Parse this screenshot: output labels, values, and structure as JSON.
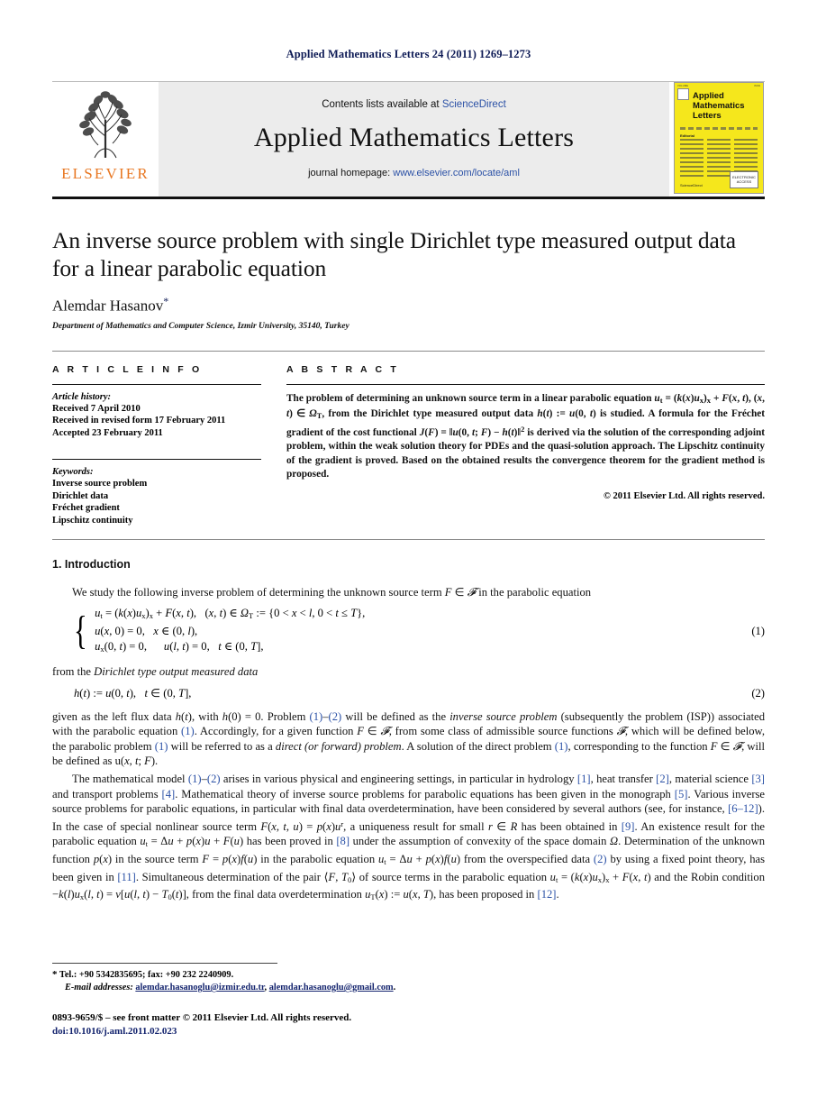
{
  "running_head": "Applied Mathematics Letters 24 (2011) 1269–1273",
  "masthead": {
    "publisher_name": "ELSEVIER",
    "contents_prefix": "Contents lists available at ",
    "contents_link": "ScienceDirect",
    "journal_title": "Applied Mathematics Letters",
    "homepage_prefix": "journal homepage: ",
    "homepage_link": "www.elsevier.com/locate/aml",
    "cover": {
      "line1": "Applied",
      "line2": "Mathematics",
      "line3": "Letters",
      "editorial_label": "Editorial",
      "sciencedirect": "ScienceDirect",
      "badge": "ELECTRONIC ACCESS"
    }
  },
  "title": "An inverse source problem with single Dirichlet type measured output data for a linear parabolic equation",
  "author": "Alemdar Hasanov",
  "author_marker": "*",
  "affiliation": "Department of Mathematics and Computer Science, Izmir University, 35140, Turkey",
  "article_info": {
    "heading": "A R T I C L E    I N F O",
    "history_label": "Article history:",
    "history": [
      "Received 7 April 2010",
      "Received in revised form 17 February 2011",
      "Accepted 23 February 2011"
    ],
    "keywords_label": "Keywords:",
    "keywords": [
      "Inverse source problem",
      "Dirichlet data",
      "Fréchet gradient",
      "Lipschitz continuity"
    ]
  },
  "abstract": {
    "heading": "A B S T R A C T",
    "text": "The problem of determining an unknown source term in a linear parabolic equation u_t = (k(x)u_x)_x + F(x, t), (x, t) ∈ Ω_T, from the Dirichlet type measured output data h(t) := u(0, t) is studied. A formula for the Fréchet gradient of the cost functional J(F) = ‖u(0, t; F) − h(t)‖² is derived via the solution of the corresponding adjoint problem, within the weak solution theory for PDEs and the quasi-solution approach. The Lipschitz continuity of the gradient is proved. Based on the obtained results the convergence theorem for the gradient method is proposed.",
    "copyright": "© 2011 Elsevier Ltd. All rights reserved."
  },
  "body": {
    "section_number_title": "1.  Introduction",
    "lead": "We study the following inverse problem of determining the unknown source term F ∈ 𝓕 in the parabolic equation",
    "eq1": {
      "line1": "u_t = (k(x)u_x)_x + F(x, t),   (x, t) ∈ Ω_T := {0 < x < l, 0 < t ≤ T},",
      "line2": "u(x, 0) = 0,   x ∈ (0, l),",
      "line3": "u_x(0, t) = 0,      u(l, t) = 0,   t ∈ (0, T],",
      "number": "(1)"
    },
    "from_line": "from the Dirichlet type output measured data",
    "eq2": {
      "line": "h(t) := u(0, t),   t ∈ (0, T],",
      "number": "(2)"
    },
    "para_given": "given as the left flux data h(t), with h(0) = 0. Problem (1)–(2) will be defined as the inverse source problem (subsequently the problem (ISP)) associated with the parabolic equation (1). Accordingly, for a given function F ∈ 𝓕, from some class of admissible source functions 𝓕, which will be defined below, the parabolic problem (1) will be referred to as a direct (or forward) problem. A solution of the direct problem (1), corresponding to the function F ∈ 𝓕, will be defined as u(x, t; F).",
    "para_model": "The mathematical model (1)–(2) arises in various physical and engineering settings, in particular in hydrology [1], heat transfer [2], material science [3] and transport problems [4]. Mathematical theory of inverse source problems for parabolic equations has been given in the monograph [5]. Various inverse source problems for parabolic equations, in particular with final data overdetermination, have been considered by several authors (see, for instance, [6–12]). In the case of special nonlinear source term F(x, t, u) = p(x)u^r, a uniqueness result for small r ∈ R has been obtained in [9]. An existence result for the parabolic equation u_t = Δu + p(x)u + F(u) has been proved in [8] under the assumption of convexity of the space domain Ω. Determination of the unknown function p(x) in the source term F = p(x)f(u) in the parabolic equation u_t = Δu + p(x)f(u) from the overspecified data (2) by using a fixed point theory, has been given in [11]. Simultaneous determination of the pair ⟨F, T_0⟩ of source terms in the parabolic equation u_t = (k(x)u_x)_x + F(x, t) and the Robin condition −k(l)u_x(l, t) = v[u(l, t) − T_0(t)], from the final data overdetermination u_T(x) := u(x, T), has been proposed in [12]."
  },
  "footnote": {
    "marker": "*",
    "tel_fax": "Tel.: +90 5342835695; fax: +90 232 2240909.",
    "email_label": "E-mail addresses:",
    "email1": "alemdar.hasanoglu@izmir.edu.tr",
    "email_sep": ",",
    "email2": "alemdar.hasanoglu@gmail.com",
    "email_end": "."
  },
  "colophon": {
    "issn_line": "0893-9659/$ – see front matter © 2011 Elsevier Ltd. All rights reserved.",
    "doi": "doi:10.1016/j.aml.2011.02.023"
  }
}
